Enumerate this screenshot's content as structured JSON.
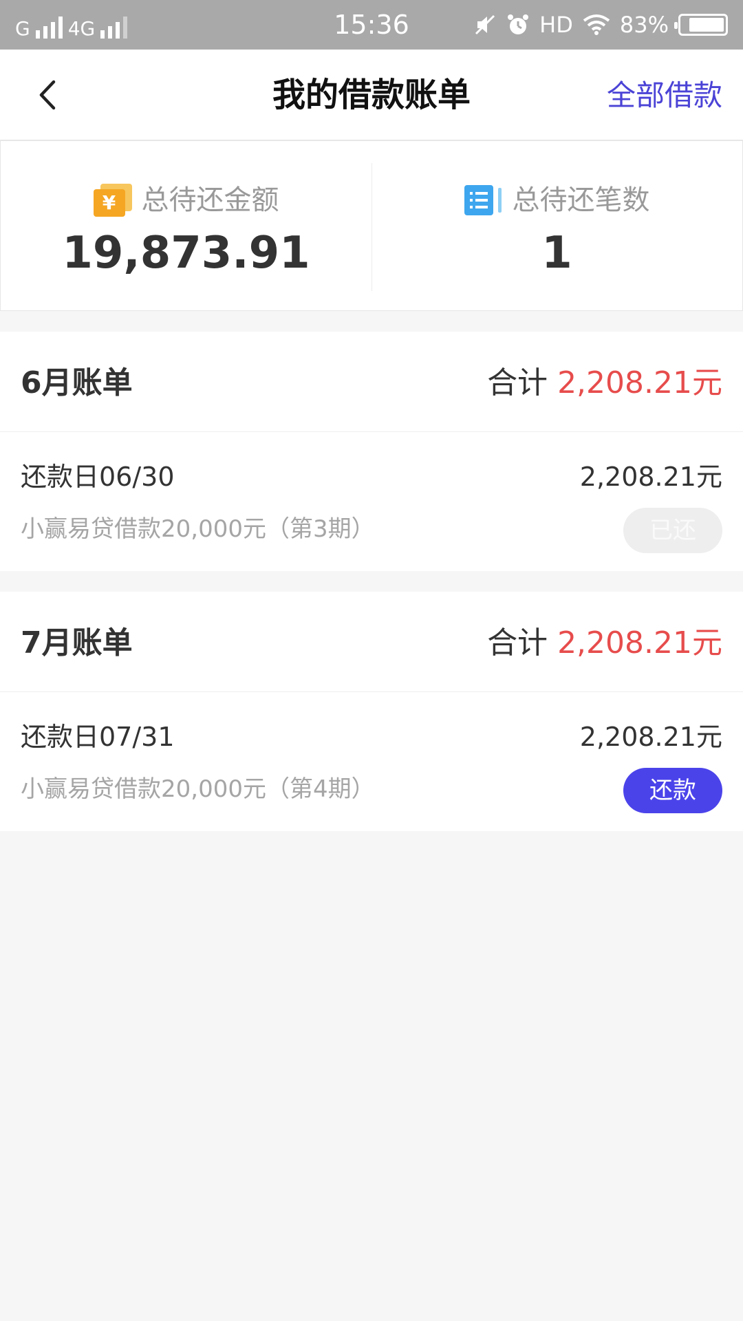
{
  "status_bar": {
    "net1": "G",
    "net2": "4G",
    "time": "15:36",
    "hd": "HD",
    "battery": "83%",
    "battery_level": 0.83
  },
  "nav": {
    "title": "我的借款账单",
    "right_link": "全部借款",
    "back_icon": "chevron-left-icon"
  },
  "summary": {
    "amount_label": "总待还金额",
    "amount_value": "19,873.91",
    "amount_icon": "yuan-coin-icon",
    "count_label": "总待还笔数",
    "count_value": "1",
    "count_icon": "list-doc-icon"
  },
  "bills": [
    {
      "month": "6月账单",
      "total_label": "合计",
      "total_amount": "2,208.21元",
      "due": "还款日06/30",
      "amount": "2,208.21元",
      "loan": "小赢易贷借款20,000元（第3期）",
      "action": "已还",
      "status": "paid"
    },
    {
      "month": "7月账单",
      "total_label": "合计",
      "total_amount": "2,208.21元",
      "due": "还款日07/31",
      "amount": "2,208.21元",
      "loan": "小赢易贷借款20,000元（第4期）",
      "action": "还款",
      "status": "unpaid"
    }
  ],
  "colors": {
    "accent": "#4b43ea",
    "total_red": "#e74c4c",
    "coin": "#f5a623",
    "list": "#3ea6ee"
  }
}
